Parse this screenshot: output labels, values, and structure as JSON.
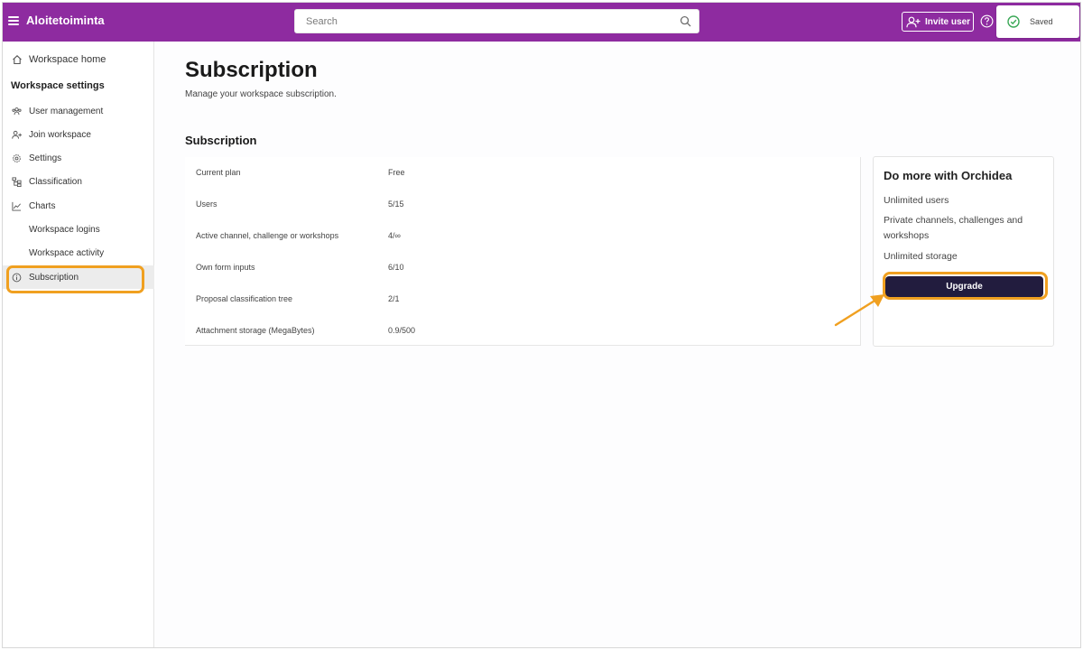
{
  "header": {
    "app_title": "Aloitetoiminta",
    "search_placeholder": "Search",
    "invite_label": "Invite user",
    "saved_label": "Saved",
    "accent_color": "#8e2ba0"
  },
  "sidebar": {
    "home_label": "Workspace home",
    "heading": "Workspace settings",
    "items": [
      {
        "label": "User management",
        "icon": "users-icon"
      },
      {
        "label": "Join workspace",
        "icon": "person-add-icon"
      },
      {
        "label": "Settings",
        "icon": "gear-icon"
      },
      {
        "label": "Classification",
        "icon": "tree-icon"
      },
      {
        "label": "Charts",
        "icon": "chart-icon"
      },
      {
        "label": "Workspace logins",
        "icon": ""
      },
      {
        "label": "Workspace activity",
        "icon": ""
      },
      {
        "label": "Subscription",
        "icon": "info-icon",
        "active": true
      }
    ]
  },
  "main": {
    "title": "Subscription",
    "subtitle": "Manage your workspace subscription.",
    "section_title": "Subscription",
    "plan_rows": [
      {
        "key": "Current plan",
        "value": "Free"
      },
      {
        "key": "Users",
        "value": "5/15"
      },
      {
        "key": "Active channel, challenge or workshops",
        "value": "4/∞"
      },
      {
        "key": "Own form inputs",
        "value": "6/10"
      },
      {
        "key": "Proposal classification tree",
        "value": "2/1"
      },
      {
        "key": "Attachment storage (MegaBytes)",
        "value": "0.9/500"
      }
    ]
  },
  "upsell": {
    "title": "Do more with Orchidea",
    "features": [
      "Unlimited users",
      "Private channels, challenges and workshops",
      "Unlimited storage"
    ],
    "button_label": "Upgrade",
    "button_color": "#221c3e",
    "highlight_color": "#f0a020"
  }
}
